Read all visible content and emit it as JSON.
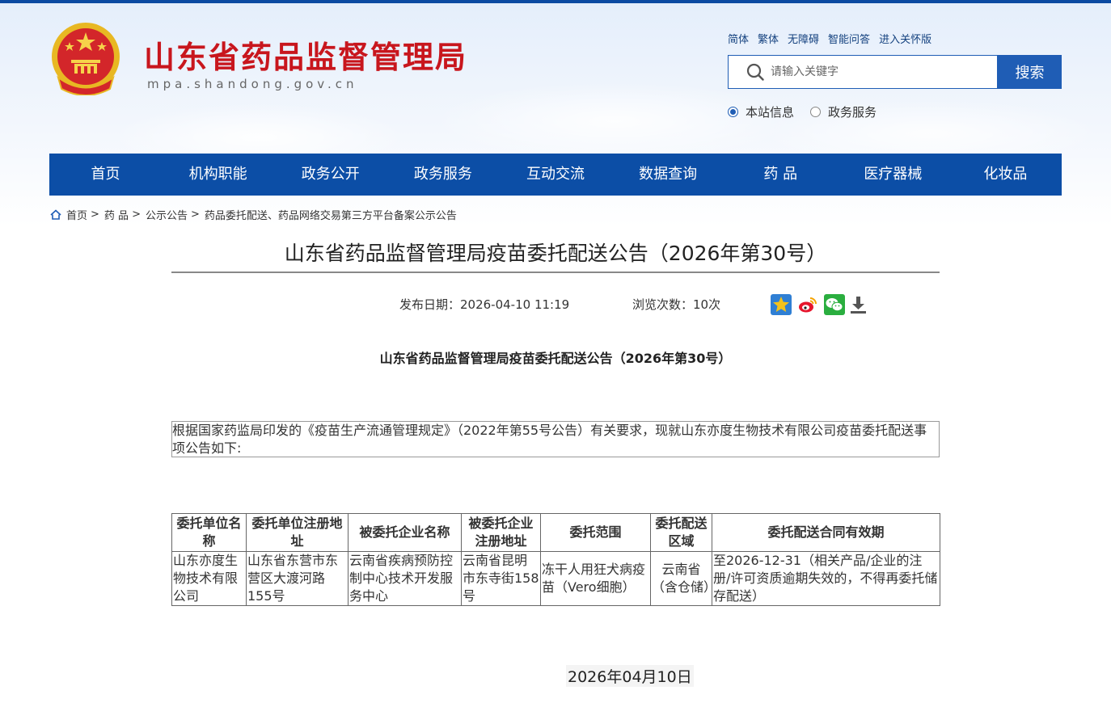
{
  "header": {
    "site_title": "山东省药品监督管理局",
    "site_domain": "mpa.shandong.gov.cn",
    "top_links": [
      "简体",
      "繁体",
      "无障碍",
      "智能问答",
      "进入关怀版"
    ],
    "search": {
      "placeholder": "请输入关键字",
      "button_label": "搜索"
    },
    "scope_options": [
      {
        "label": "本站信息",
        "selected": true
      },
      {
        "label": "政务服务",
        "selected": false
      }
    ]
  },
  "nav": {
    "items": [
      "首页",
      "机构职能",
      "政务公开",
      "政务服务",
      "互动交流",
      "数据查询",
      "药 品",
      "医疗器械",
      "化妆品"
    ]
  },
  "breadcrumb": {
    "items": [
      "首页",
      "药 品",
      "公示公告",
      "药品委托配送、药品网络交易第三方平台备案公示公告"
    ],
    "separator": ">"
  },
  "article": {
    "title": "山东省药品监督管理局疫苗委托配送公告（2026年第30号）",
    "publish_date": "发布日期：2026-04-10 11:19",
    "views": "浏览次数：10次",
    "sub_title": "山东省药品监督管理局疫苗委托配送公告（2026年第30号）",
    "intro": "根据国家药监局印发的《疫苗生产流通管理规定》（2022年第55号公告）有关要求，现就山东亦度生物技术有限公司疫苗委托配送事项公告如下:",
    "table": {
      "headers": [
        "委托单位名称",
        "委托单位注册地址",
        "被委托企业名称",
        "被委托企业注册地址",
        "委托范围",
        "委托配送区域",
        "委托配送合同有效期"
      ],
      "rows": [
        [
          "山东亦度生物技术有限公司",
          "山东省东营市东营区大渡河路155号",
          "云南省疾病预防控制中心技术开发服务中心",
          "云南省昆明市东寺街158号",
          "冻干人用狂犬病疫苗（Vero细胞）",
          "云南省（含仓储）",
          "至2026-12-31（相关产品/企业的注册/许可资质逾期失效的，不得再委托储存配送）"
        ]
      ]
    },
    "footer_date": "2026年04月10日"
  },
  "colors": {
    "brand_red": "#c8161d",
    "nav_blue": "#0c4ea6",
    "search_blue": "#1f5db5"
  }
}
